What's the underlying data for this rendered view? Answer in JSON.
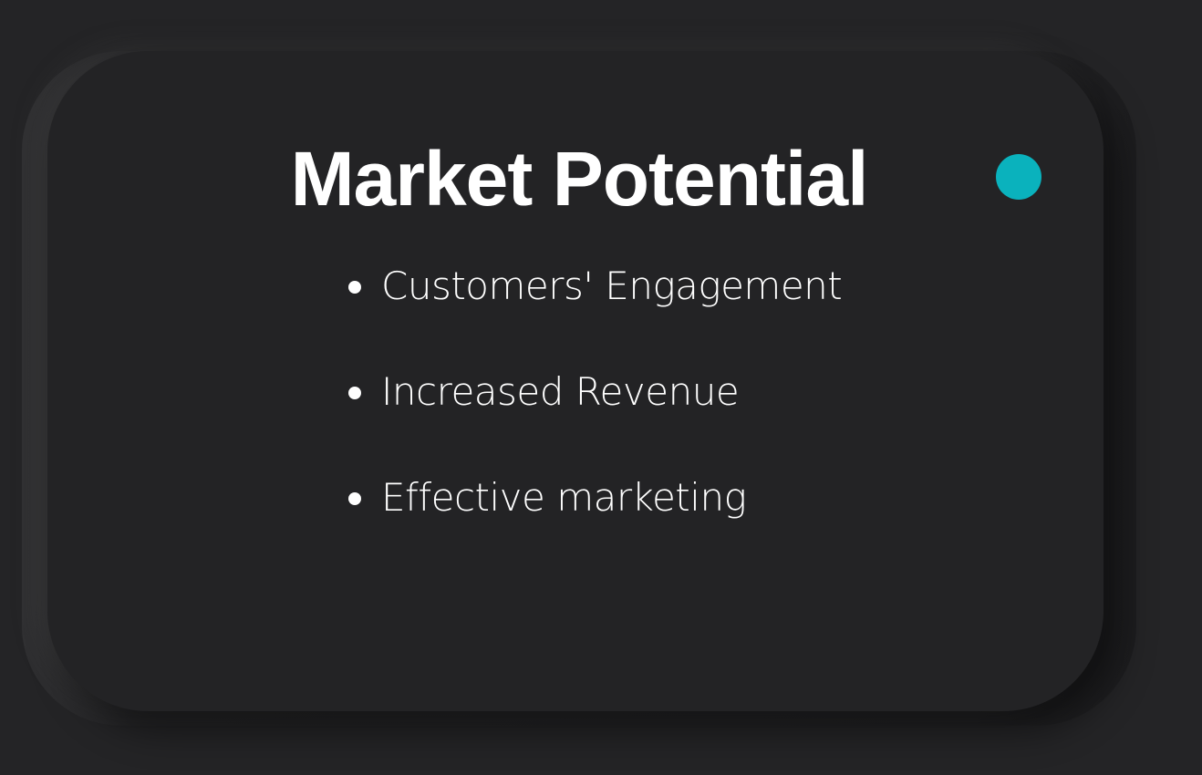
{
  "slide": {
    "title": "Market Potential",
    "accent_color": "#0ab2bd",
    "background_color": "#242426",
    "card_color": "#232325",
    "bullets": [
      "Customers' Engagement",
      "Increased Revenue",
      "Effective marketing"
    ]
  }
}
